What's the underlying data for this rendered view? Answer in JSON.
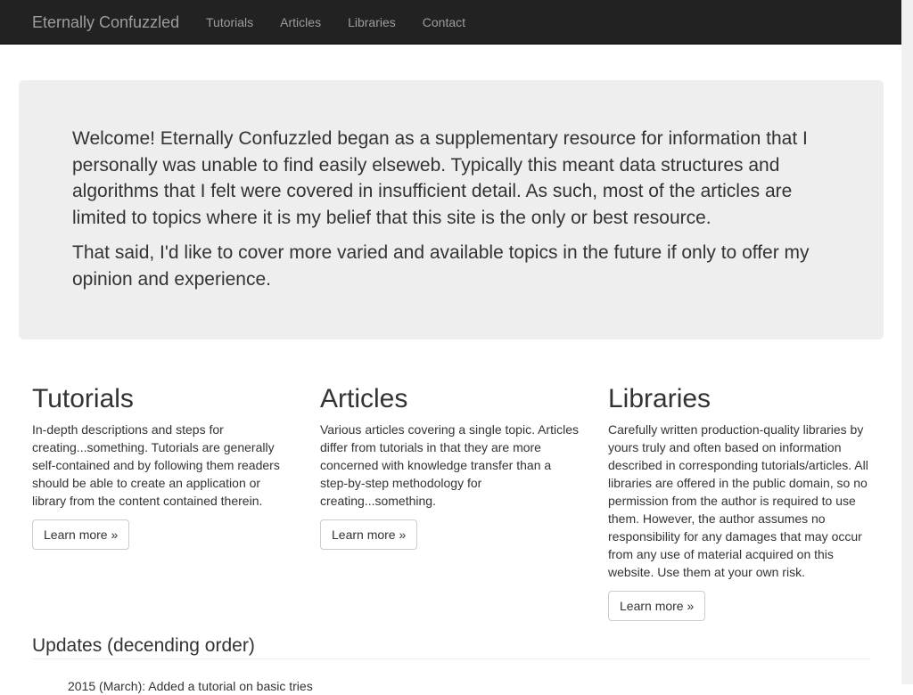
{
  "navbar": {
    "brand": "Eternally Confuzzled",
    "links": [
      "Tutorials",
      "Articles",
      "Libraries",
      "Contact"
    ]
  },
  "jumbotron": {
    "paragraphs": [
      "Welcome! Eternally Confuzzled began as a supplementary resource for information that I personally was unable to find easily elseweb. Typically this meant data structures and algorithms that I felt were covered in insufficient detail. As such, most of the articles are limited to topics where it is my belief that this site is the only or best resource.",
      "That said, I'd like to cover more varied and available topics in the future if only to offer my opinion and experience."
    ]
  },
  "columns": [
    {
      "title": "Tutorials",
      "text": "In-depth descriptions and steps for creating...something. Tutorials are generally self-contained and by following them readers should be able to create an application or library from the content contained therein.",
      "button": "Learn more »"
    },
    {
      "title": "Articles",
      "text": "Various articles covering a single topic. Articles differ from tutorials in that they are more concerned with knowledge transfer than a step-by-step methodology for creating...something.",
      "button": "Learn more »"
    },
    {
      "title": "Libraries",
      "text": "Carefully written production-quality libraries by yours truly and often based on information described in corresponding tutorials/articles. All libraries are offered in the public domain, so no permission from the author is required to use them. However, the author assumes no responsibility for any damages that may occur from any use of material acquired on this website. Use them at your own risk.",
      "button": "Learn more »"
    }
  ],
  "updates": {
    "title": "Updates (decending order)",
    "items": [
      "2015 (March): Added a tutorial on basic tries"
    ]
  }
}
